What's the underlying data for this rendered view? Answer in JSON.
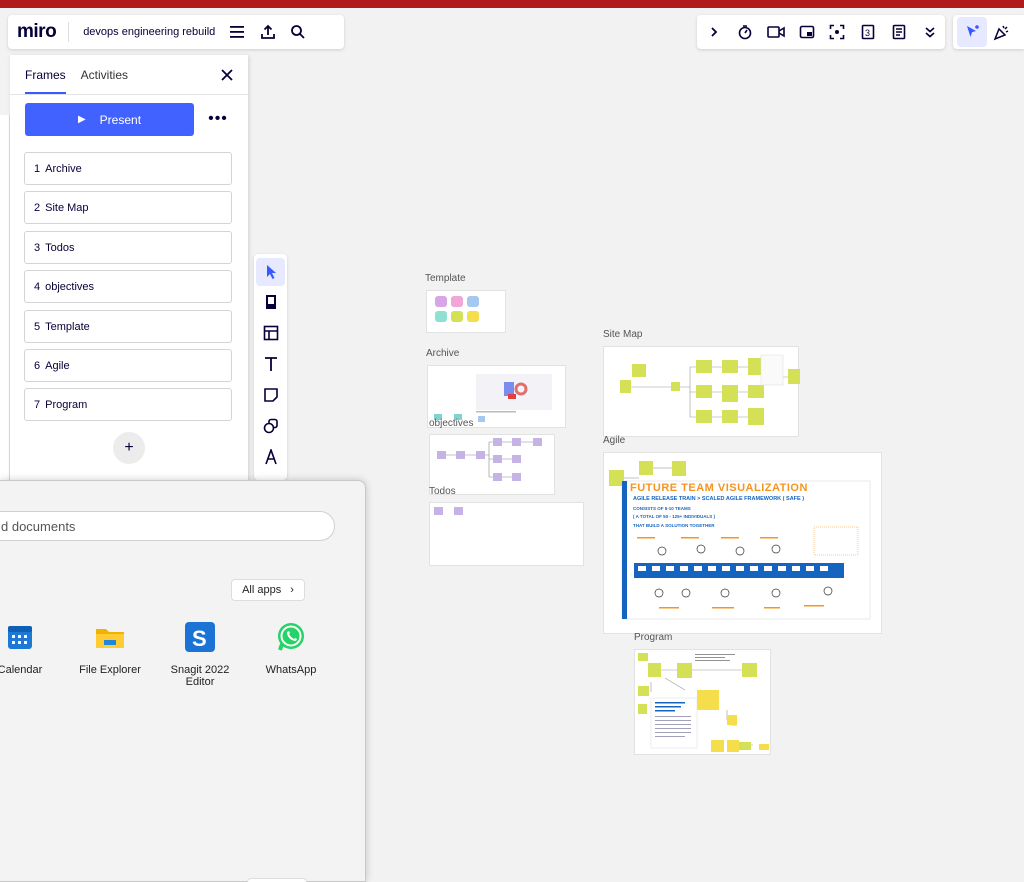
{
  "app": {
    "logo": "miro",
    "board_name": "devops engineering rebuild"
  },
  "panel": {
    "tabs": [
      "Frames",
      "Activities"
    ],
    "present_label": "Present",
    "frames": [
      {
        "num": "1",
        "name": "Archive"
      },
      {
        "num": "2",
        "name": "Site Map"
      },
      {
        "num": "3",
        "name": "Todos"
      },
      {
        "num": "4",
        "name": "objectives"
      },
      {
        "num": "5",
        "name": "Template"
      },
      {
        "num": "6",
        "name": "Agile"
      },
      {
        "num": "7",
        "name": "Program"
      }
    ],
    "add_label": "+"
  },
  "board": {
    "labels": {
      "template": "Template",
      "archive": "Archive",
      "objectives": "objectives",
      "todos": "Todos",
      "site_map": "Site Map",
      "agile": "Agile",
      "program": "Program"
    },
    "agile_heading": "FUTURE TEAM VISUALIZATION",
    "agile_sub1": "AGILE RELEASE TRAIN > SCALED AGILE FRAMEWORK ( SAFE )",
    "agile_sub2": "CONSISTS OF 5-10 TEAMS",
    "agile_sub3": "( A TOTAL OF 50 - 125+ INDIVIDUALS )",
    "agile_sub4": "THAT BUILD A SOLUTION TOGETHER"
  },
  "start_menu": {
    "search_placeholder": "d documents",
    "all_apps": "All apps",
    "apps": [
      {
        "name": "Calendar",
        "icon": "calendar-icon"
      },
      {
        "name": "File Explorer",
        "icon": "folder-icon"
      },
      {
        "name": "Snagit 2022 Editor",
        "icon": "snagit-icon"
      },
      {
        "name": "WhatsApp",
        "icon": "whatsapp-icon"
      }
    ]
  },
  "colors": {
    "accent": "#4262ff",
    "sticky_green": "#d4e157",
    "sticky_yellow": "#fff176",
    "sticky_purple": "#c5b3e6",
    "agile_orange": "#f7941d",
    "agile_blue": "#1565c0"
  }
}
